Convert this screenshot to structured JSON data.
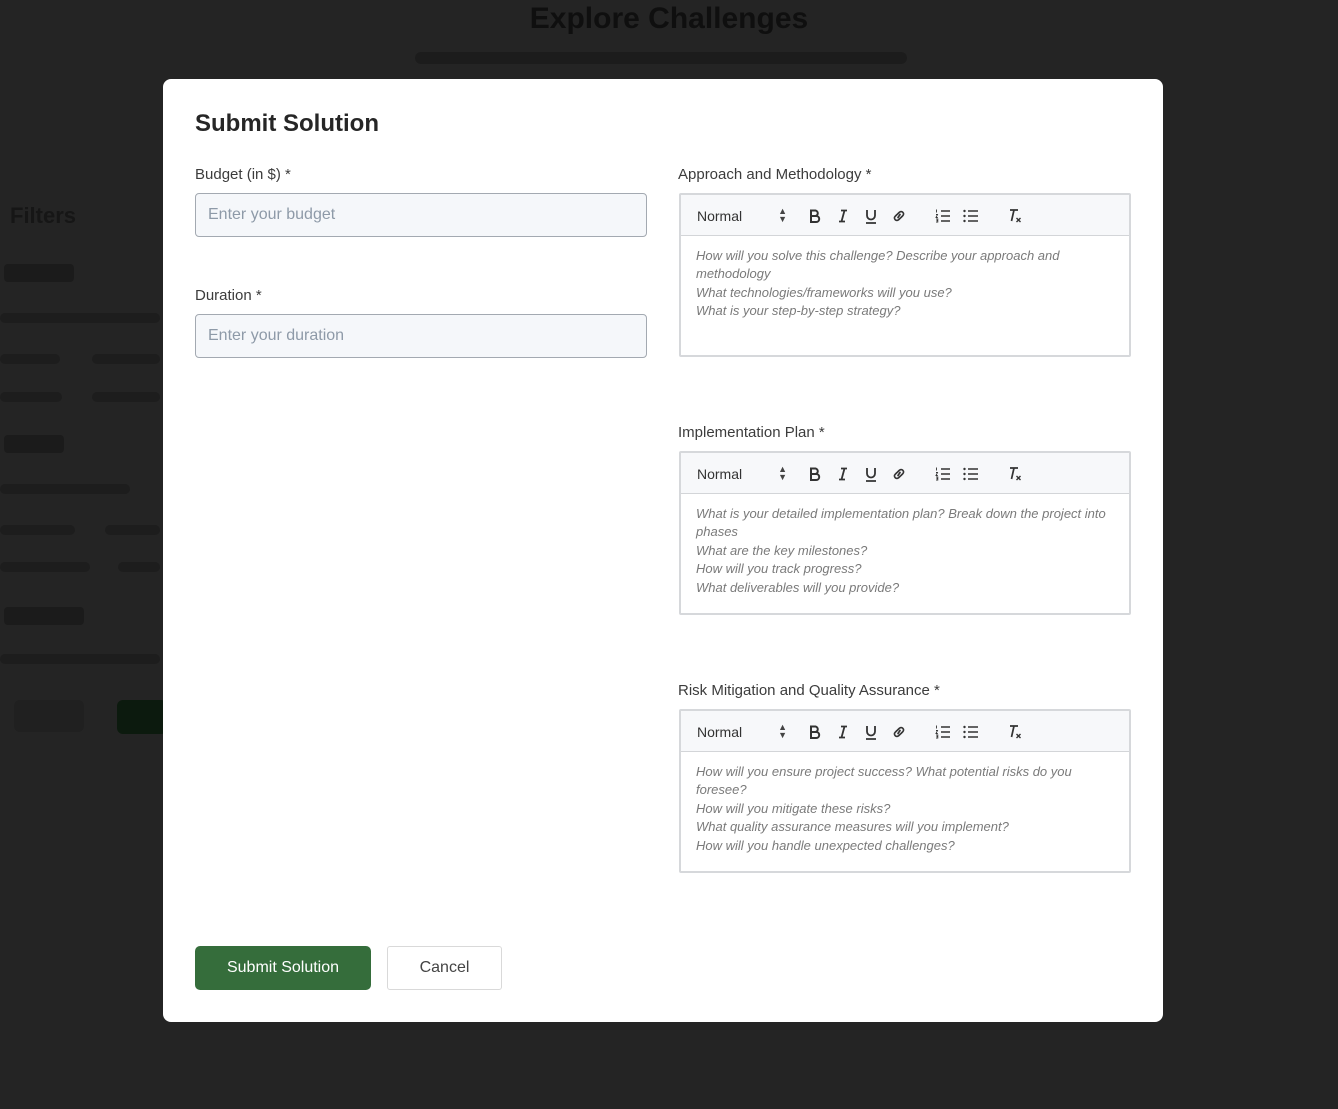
{
  "background": {
    "page_title": "Explore Challenges",
    "filters_heading": "Filters"
  },
  "modal": {
    "title": "Submit Solution",
    "budget": {
      "label": "Budget (in $) *",
      "placeholder": "Enter your budget",
      "value": ""
    },
    "duration": {
      "label": "Duration *",
      "placeholder": "Enter your duration",
      "value": ""
    },
    "editors": [
      {
        "label": "Approach and Methodology *",
        "format": "Normal",
        "placeholder_lines": [
          "How will you solve this challenge? Describe your approach and methodology",
          "What technologies/frameworks will you use?",
          "What is your step-by-step strategy?"
        ]
      },
      {
        "label": "Implementation Plan *",
        "format": "Normal",
        "placeholder_lines": [
          "What is your detailed implementation plan? Break down the project into phases",
          "What are the key milestones?",
          "How will you track progress?",
          "What deliverables will you provide?"
        ]
      },
      {
        "label": "Risk Mitigation and Quality Assurance *",
        "format": "Normal",
        "placeholder_lines": [
          "How will you ensure project success? What potential risks do you foresee?",
          "How will you mitigate these risks?",
          "What quality assurance measures will you implement?",
          "How will you handle unexpected challenges?"
        ]
      }
    ],
    "toolbar_icons": [
      "bold-icon",
      "italic-icon",
      "underline-icon",
      "link-icon",
      "ordered-list-icon",
      "bullet-list-icon",
      "clear-format-icon"
    ],
    "submit_label": "Submit Solution",
    "cancel_label": "Cancel"
  },
  "colors": {
    "overlay": "#242424",
    "primary_button": "#356d3b",
    "input_background": "#f5f7fa"
  }
}
